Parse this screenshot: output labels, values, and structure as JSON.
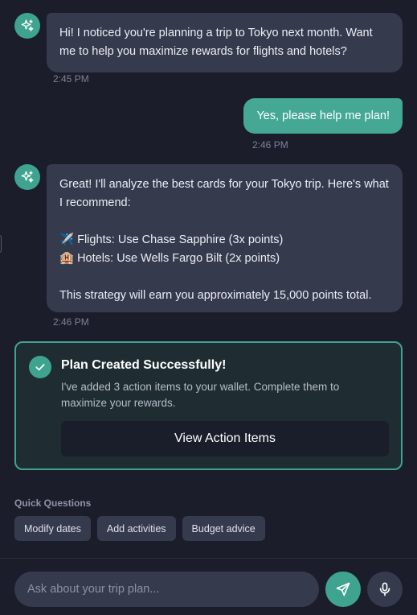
{
  "messages": [
    {
      "from": "assistant",
      "lines": [
        "Hi! I noticed you're planning a trip to Tokyo next month. Want me to help you maximize rewards for flights and hotels?"
      ],
      "time": "2:45 PM"
    },
    {
      "from": "user",
      "text": "Yes, please help me plan!",
      "time": "2:46 PM"
    },
    {
      "from": "assistant",
      "intro": "Great! I'll analyze the best cards for your Tokyo trip. Here's what I recommend:",
      "flights": "✈️ Flights: Use Chase Sapphire (3x points)",
      "hotels": "🏨 Hotels: Use Wells Fargo Bilt (2x points)",
      "summary": "This strategy will earn you approximately 15,000 points total.",
      "time": "2:46 PM"
    }
  ],
  "plan_card": {
    "title": "Plan Created Successfully!",
    "description": "I've added 3 action items to your wallet. Complete them to maximize your rewards.",
    "button": "View Action Items"
  },
  "quick_questions": {
    "label": "Quick Questions",
    "chips": [
      "Modify dates",
      "Add activities",
      "Budget advice"
    ]
  },
  "composer": {
    "placeholder": "Ask about your trip plan..."
  },
  "colors": {
    "accent": "#3fa48f",
    "background": "#1b1d2b",
    "bubble": "#363a4d"
  },
  "icons": {
    "assistant_avatar": "sparkles-icon",
    "success": "checkmark-icon",
    "send": "send-icon",
    "mic": "microphone-icon"
  }
}
